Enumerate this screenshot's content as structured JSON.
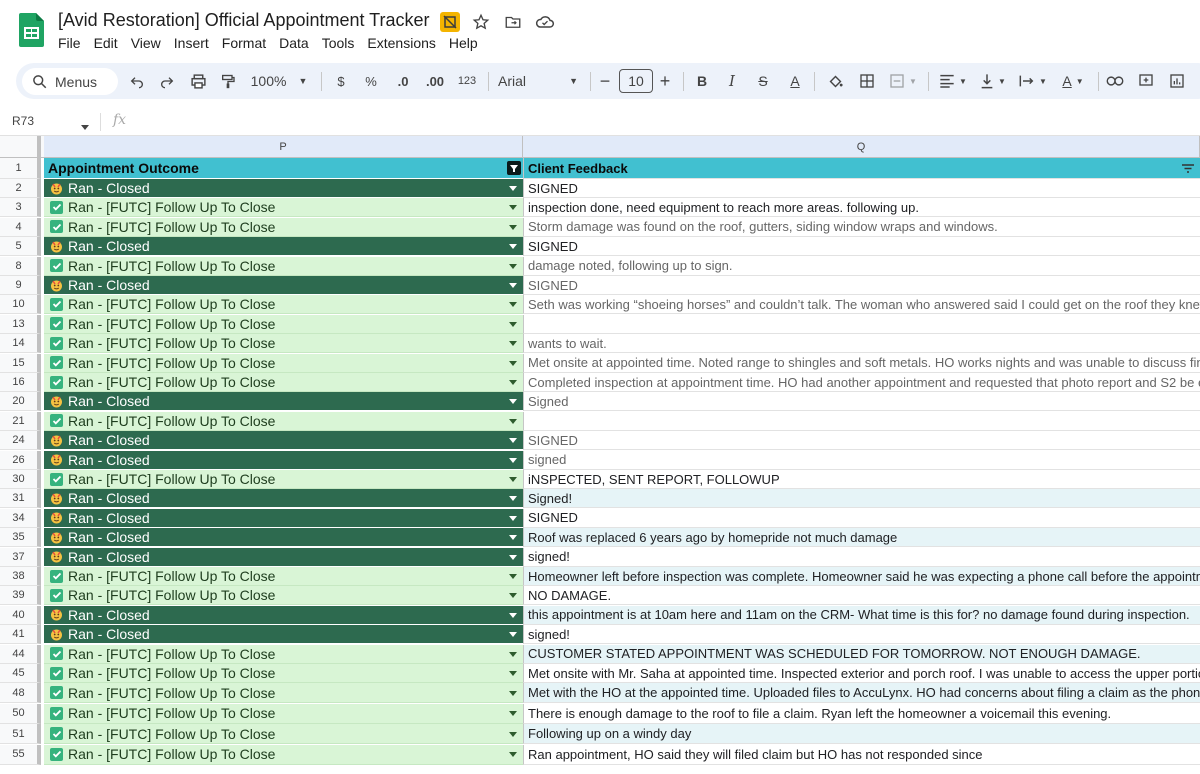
{
  "app": {
    "doc_title": "[Avid Restoration] Official Appointment Tracker",
    "menus": [
      "File",
      "Edit",
      "View",
      "Insert",
      "Format",
      "Data",
      "Tools",
      "Extensions",
      "Help"
    ]
  },
  "toolbar": {
    "search_label": "Menus",
    "zoom": "100%",
    "currency": "$",
    "percent": "%",
    "dec_less": ".0",
    "dec_more": ".00",
    "number_format": "123",
    "font": "Arial",
    "font_size": "10"
  },
  "formula_bar": {
    "name_box": "R73",
    "fx": "fx",
    "value": ""
  },
  "columns": {
    "p": "P",
    "q": "Q"
  },
  "header_row": {
    "num": "1",
    "p": "Appointment Outcome",
    "q": "Client Feedback"
  },
  "rows": [
    {
      "num": "2",
      "status": "closed",
      "outcome": "Ran - Closed",
      "feedback": "SIGNED",
      "style": "plain"
    },
    {
      "num": "3",
      "status": "futc",
      "outcome": "Ran - [FUTC] Follow Up To Close",
      "feedback": "inspection done, need equipment to reach more areas.  following up.",
      "style": "plain"
    },
    {
      "num": "4",
      "status": "futc",
      "outcome": "Ran - [FUTC] Follow Up To Close",
      "feedback": "Storm damage was found on the roof, gutters, siding window wraps and windows.",
      "style": "gray"
    },
    {
      "num": "5",
      "status": "closed",
      "outcome": "Ran - Closed",
      "feedback": "SIGNED",
      "style": "plain"
    },
    {
      "num": "8",
      "status": "futc",
      "outcome": "Ran - [FUTC] Follow Up To Close",
      "feedback": "damage noted, following up to sign.",
      "style": "gray"
    },
    {
      "num": "9",
      "status": "closed",
      "outcome": "Ran - Closed",
      "feedback": "SIGNED",
      "style": "gray"
    },
    {
      "num": "10",
      "status": "futc",
      "outcome": "Ran - [FUTC] Follow Up To Close",
      "feedback": "Seth was working “shoeing horses” and couldn’t talk. The woman who answered said I could get on the roof they knew",
      "style": "gray"
    },
    {
      "num": "13",
      "status": "futc",
      "outcome": "Ran - [FUTC] Follow Up To Close",
      "feedback": "",
      "style": "plain"
    },
    {
      "num": "14",
      "status": "futc",
      "outcome": "Ran - [FUTC] Follow Up To Close",
      "feedback": "wants to wait.",
      "style": "gray"
    },
    {
      "num": "15",
      "status": "futc",
      "outcome": "Ran - [FUTC] Follow Up To Close",
      "feedback": "Met onsite at appointed time. Noted range to shingles and soft metals. HO works nights and was unable to discuss fina",
      "style": "gray"
    },
    {
      "num": "16",
      "status": "futc",
      "outcome": "Ran - [FUTC] Follow Up To Close",
      "feedback": "Completed inspection at appointment time. HO had another appointment and requested that photo report and S2 be e",
      "style": "gray"
    },
    {
      "num": "20",
      "status": "closed",
      "outcome": "Ran - Closed",
      "feedback": "Signed",
      "style": "gray"
    },
    {
      "num": "21",
      "status": "futc",
      "outcome": "Ran - [FUTC] Follow Up To Close",
      "feedback": "",
      "style": "plain"
    },
    {
      "num": "24",
      "status": "closed",
      "outcome": "Ran - Closed",
      "feedback": "SIGNED",
      "style": "gray"
    },
    {
      "num": "26",
      "status": "closed",
      "outcome": "Ran - Closed",
      "feedback": "signed",
      "style": "gray"
    },
    {
      "num": "30",
      "status": "futc",
      "outcome": "Ran - [FUTC] Follow Up To Close",
      "feedback": "iNSPECTED, SENT REPORT, FOLLOWUP",
      "style": "plain"
    },
    {
      "num": "31",
      "status": "closed",
      "outcome": "Ran - Closed",
      "feedback": "Signed!",
      "style": "tint"
    },
    {
      "num": "34",
      "status": "closed",
      "outcome": "Ran - Closed",
      "feedback": "SIGNED",
      "style": "plain"
    },
    {
      "num": "35",
      "status": "closed",
      "outcome": "Ran - Closed",
      "feedback": "Roof was replaced 6 years ago by homepride not much damage",
      "style": "tint"
    },
    {
      "num": "37",
      "status": "closed",
      "outcome": "Ran - Closed",
      "feedback": "signed!",
      "style": "plain"
    },
    {
      "num": "38",
      "status": "futc",
      "outcome": "Ran - [FUTC] Follow Up To Close",
      "feedback": "Homeowner left before inspection was complete.  Homeowner said he was expecting a phone call before the appointm",
      "style": "tint"
    },
    {
      "num": "39",
      "status": "futc",
      "outcome": "Ran - [FUTC] Follow Up To Close",
      "feedback": "NO DAMAGE.",
      "style": "plain"
    },
    {
      "num": "40",
      "status": "closed",
      "outcome": "Ran - Closed",
      "feedback": "this appointment is at 10am here and 11am on the CRM- What time is this for? no damage found during inspection.",
      "style": "tint"
    },
    {
      "num": "41",
      "status": "closed",
      "outcome": "Ran - Closed",
      "feedback": "signed!",
      "style": "plain"
    },
    {
      "num": "44",
      "status": "futc",
      "outcome": "Ran - [FUTC] Follow Up To Close",
      "feedback": "CUSTOMER STATED APPOINTMENT WAS SCHEDULED FOR TOMORROW. NOT ENOUGH DAMAGE.",
      "style": "tint"
    },
    {
      "num": "45",
      "status": "futc",
      "outcome": "Ran - [FUTC] Follow Up To Close",
      "feedback": "Met onsite with Mr. Saha at appointed time. Inspected exterior and porch roof. I was unable to access the upper portio",
      "style": "plain"
    },
    {
      "num": "48",
      "status": "futc",
      "outcome": "Ran - [FUTC] Follow Up To Close",
      "feedback": "Met with the HO at the appointed time. Uploaded files to AccuLynx. HO had concerns about filing a claim as the phone",
      "style": "tint"
    },
    {
      "num": "50",
      "status": "futc",
      "outcome": "Ran - [FUTC] Follow Up To Close",
      "feedback": "There is enough damage to the roof to file a claim. Ryan left the homeowner a voicemail this evening.",
      "style": "plain"
    },
    {
      "num": "51",
      "status": "futc",
      "outcome": "Ran - [FUTC] Follow Up To Close",
      "feedback": "Following up on a windy day",
      "style": "tint"
    },
    {
      "num": "55",
      "status": "futc",
      "outcome": "Ran - [FUTC] Follow Up To Close",
      "feedback": "Ran appointment, HO said they will filed claim but HO has not responded since",
      "style": "plain"
    }
  ],
  "colors": {
    "closed_bg": "#2d6a4f",
    "futc_bg": "#d9f5d6",
    "header_bg": "#41c0d0",
    "check": "#36b37e"
  }
}
